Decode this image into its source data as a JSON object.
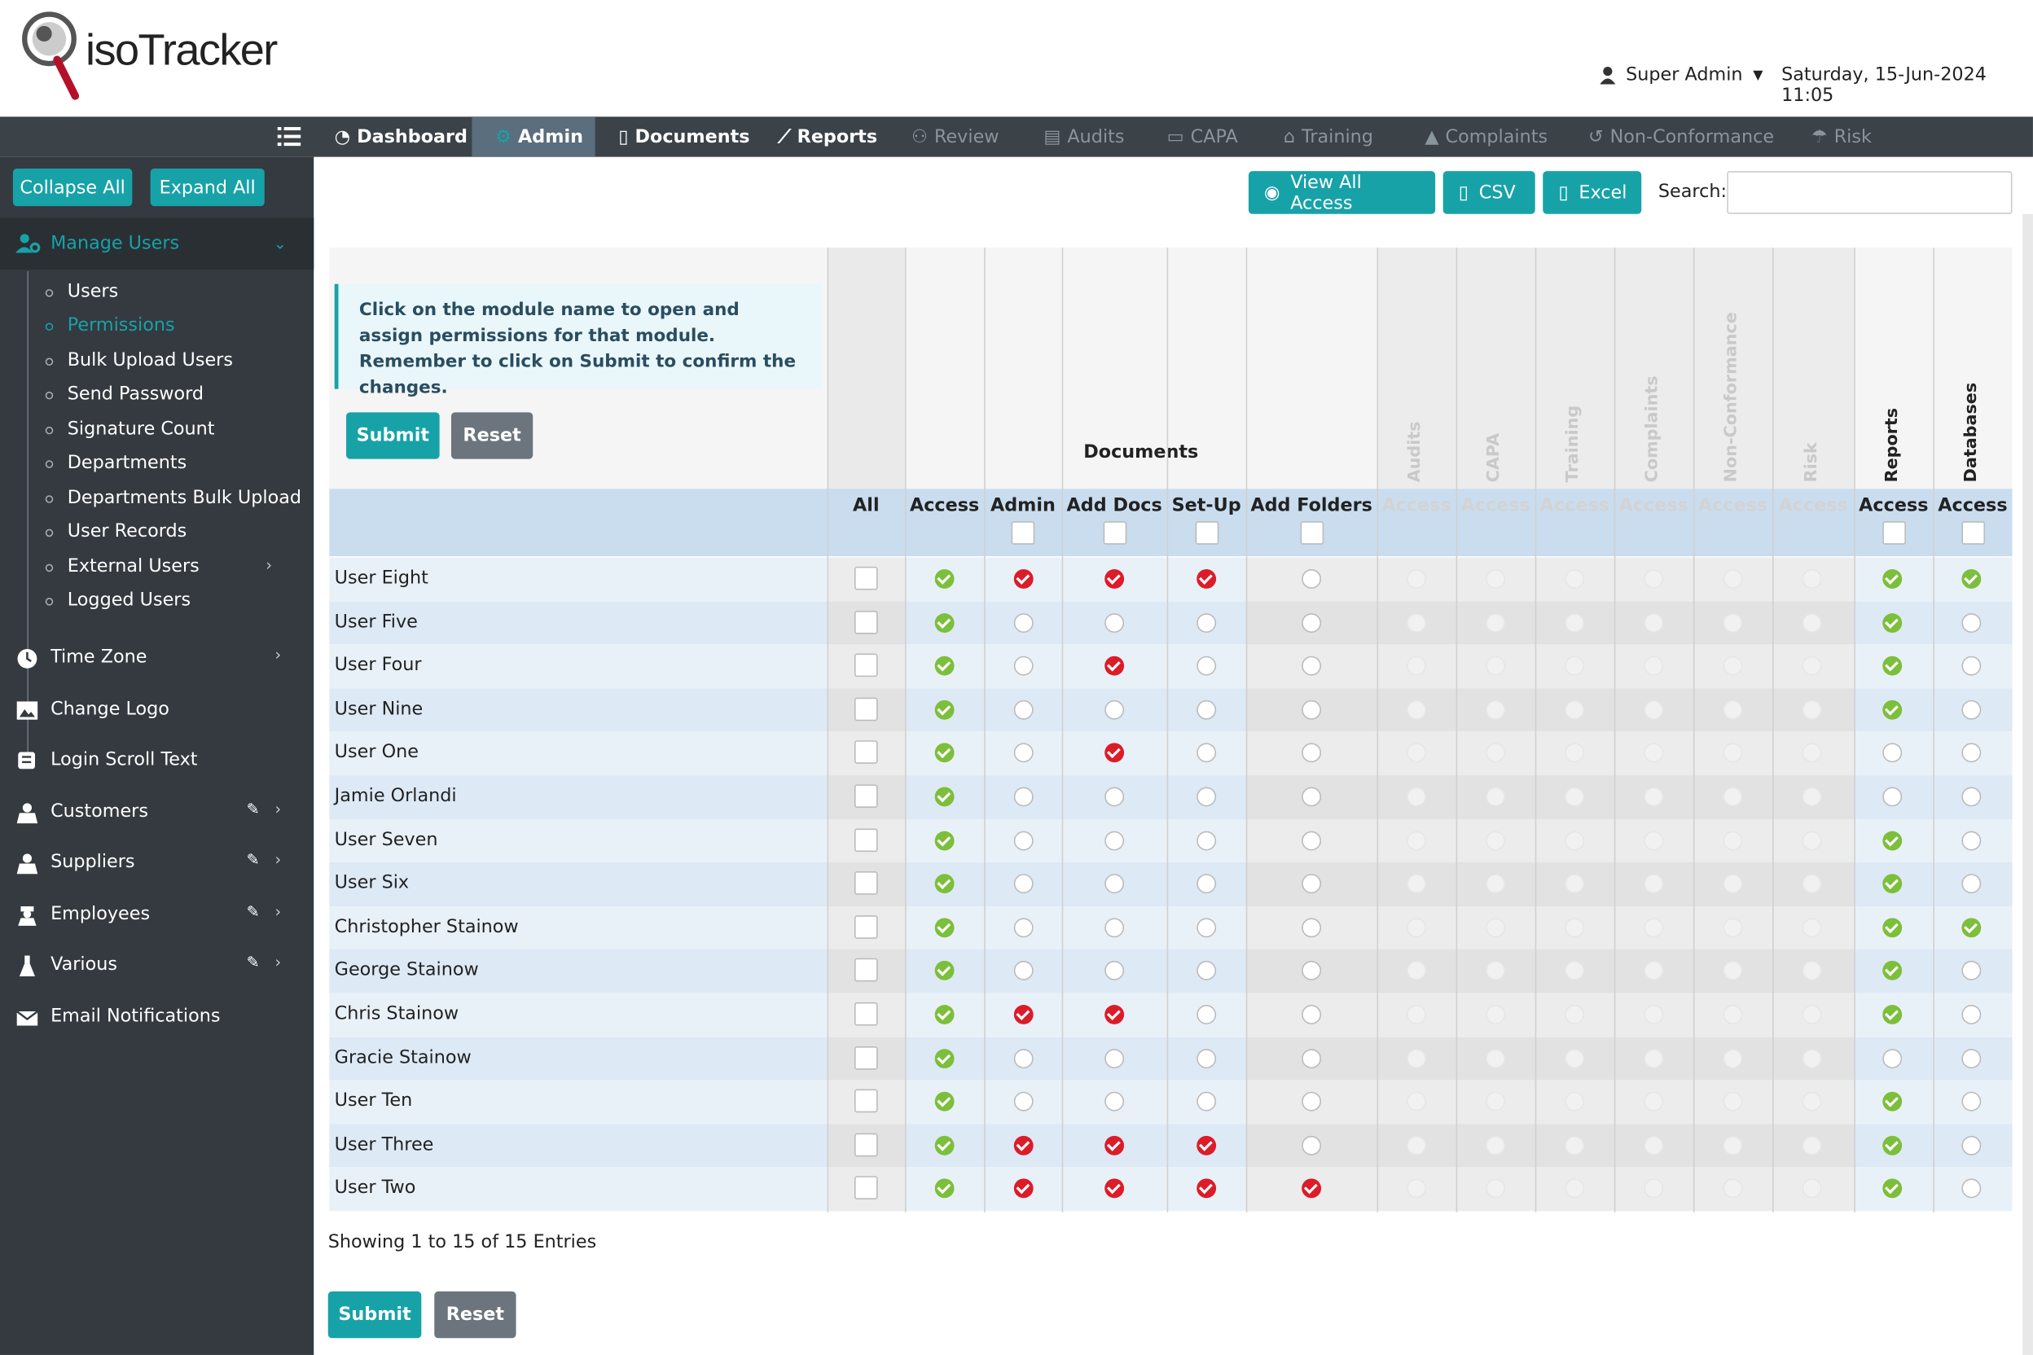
{
  "app": {
    "logo_text": "isoTracker"
  },
  "header": {
    "user_label": "Super Admin",
    "datetime": "Saturday, 15-Jun-2024 11:05"
  },
  "nav": {
    "items": [
      {
        "label": "Dashboard",
        "icon": "dashboard-icon",
        "state": "normal"
      },
      {
        "label": "Admin",
        "icon": "gear-icon",
        "state": "active"
      },
      {
        "label": "Documents",
        "icon": "document-icon",
        "state": "normal"
      },
      {
        "label": "Reports",
        "icon": "chart-icon",
        "state": "normal"
      },
      {
        "label": "Review",
        "icon": "users-icon",
        "state": "dim"
      },
      {
        "label": "Audits",
        "icon": "list-icon",
        "state": "dim"
      },
      {
        "label": "CAPA",
        "icon": "capa-icon",
        "state": "dim"
      },
      {
        "label": "Training",
        "icon": "graduation-icon",
        "state": "dim"
      },
      {
        "label": "Complaints",
        "icon": "warning-icon",
        "state": "dim"
      },
      {
        "label": "Non-Conformance",
        "icon": "history-icon",
        "state": "dim"
      },
      {
        "label": "Risk",
        "icon": "umbrella-icon",
        "state": "dim"
      }
    ]
  },
  "sidebar": {
    "collapse_label": "Collapse All",
    "expand_label": "Expand All",
    "manage_users": "Manage Users",
    "sub_items": [
      "Users",
      "Permissions",
      "Bulk Upload Users",
      "Send Password",
      "Signature Count",
      "Departments",
      "Departments Bulk Upload",
      "User Records",
      "External Users",
      "Logged Users"
    ],
    "active_sub": "Permissions",
    "items": [
      {
        "label": "Time Zone",
        "icon": "clock-icon"
      },
      {
        "label": "Change Logo",
        "icon": "image-icon"
      },
      {
        "label": "Login Scroll Text",
        "icon": "scroll-icon"
      },
      {
        "label": "Customers",
        "icon": "customers-icon"
      },
      {
        "label": "Suppliers",
        "icon": "suppliers-icon"
      },
      {
        "label": "Employees",
        "icon": "employees-icon"
      },
      {
        "label": "Various",
        "icon": "flask-icon"
      },
      {
        "label": "Email Notifications",
        "icon": "envelope-icon"
      }
    ]
  },
  "toolbar": {
    "view_all_label": "View All Access",
    "csv_label": "CSV",
    "excel_label": "Excel",
    "search_label": "Search:",
    "search_value": ""
  },
  "info_text": "Click on the module name to open and assign permissions for that module. Remember to click on Submit to confirm the changes.",
  "buttons": {
    "submit": "Submit",
    "reset": "Reset"
  },
  "table": {
    "group_header": "Documents",
    "rotated_headers": [
      "Audits",
      "CAPA",
      "Training",
      "Complaints",
      "Non-Conformance",
      "Risk",
      "Reports",
      "Databases"
    ],
    "columns": [
      "All",
      "Access",
      "Admin",
      "Add Docs",
      "Set-Up",
      "Add Folders",
      "Access",
      "Access",
      "Access",
      "Access",
      "Access",
      "Access",
      "Access",
      "Access"
    ],
    "rows": [
      {
        "name": "User Eight",
        "doc": [
          "g",
          "r",
          "r",
          "r",
          "o"
        ],
        "rep": "g",
        "db": "g"
      },
      {
        "name": "User Five",
        "doc": [
          "g",
          "o",
          "o",
          "o",
          "o"
        ],
        "rep": "g",
        "db": "o"
      },
      {
        "name": "User Four",
        "doc": [
          "g",
          "o",
          "r",
          "o",
          "o"
        ],
        "rep": "g",
        "db": "o"
      },
      {
        "name": "User Nine",
        "doc": [
          "g",
          "o",
          "o",
          "o",
          "o"
        ],
        "rep": "g",
        "db": "o"
      },
      {
        "name": "User One",
        "doc": [
          "g",
          "o",
          "r",
          "o",
          "o"
        ],
        "rep": "o",
        "db": "o"
      },
      {
        "name": "Jamie Orlandi",
        "doc": [
          "g",
          "o",
          "o",
          "o",
          "o"
        ],
        "rep": "o",
        "db": "o"
      },
      {
        "name": "User Seven",
        "doc": [
          "g",
          "o",
          "o",
          "o",
          "o"
        ],
        "rep": "g",
        "db": "o"
      },
      {
        "name": "User Six",
        "doc": [
          "g",
          "o",
          "o",
          "o",
          "o"
        ],
        "rep": "g",
        "db": "o"
      },
      {
        "name": "Christopher Stainow",
        "doc": [
          "g",
          "o",
          "o",
          "o",
          "o"
        ],
        "rep": "g",
        "db": "g"
      },
      {
        "name": "George Stainow",
        "doc": [
          "g",
          "o",
          "o",
          "o",
          "o"
        ],
        "rep": "g",
        "db": "o"
      },
      {
        "name": "Chris Stainow",
        "doc": [
          "g",
          "r",
          "r",
          "o",
          "o"
        ],
        "rep": "g",
        "db": "o"
      },
      {
        "name": "Gracie Stainow",
        "doc": [
          "g",
          "o",
          "o",
          "o",
          "o"
        ],
        "rep": "o",
        "db": "o"
      },
      {
        "name": "User Ten",
        "doc": [
          "g",
          "o",
          "o",
          "o",
          "o"
        ],
        "rep": "g",
        "db": "o"
      },
      {
        "name": "User Three",
        "doc": [
          "g",
          "r",
          "r",
          "r",
          "o"
        ],
        "rep": "g",
        "db": "o"
      },
      {
        "name": "User Two",
        "doc": [
          "g",
          "r",
          "r",
          "r",
          "r"
        ],
        "rep": "g",
        "db": "o"
      }
    ]
  },
  "footer": {
    "showing": "Showing 1 to 15 of 15 Entries"
  },
  "colors": {
    "teal": "#17a2a8",
    "navbar": "#3b4349",
    "sidebar": "#343a40",
    "green": "#7cbf3b",
    "red": "#dc1c28"
  }
}
